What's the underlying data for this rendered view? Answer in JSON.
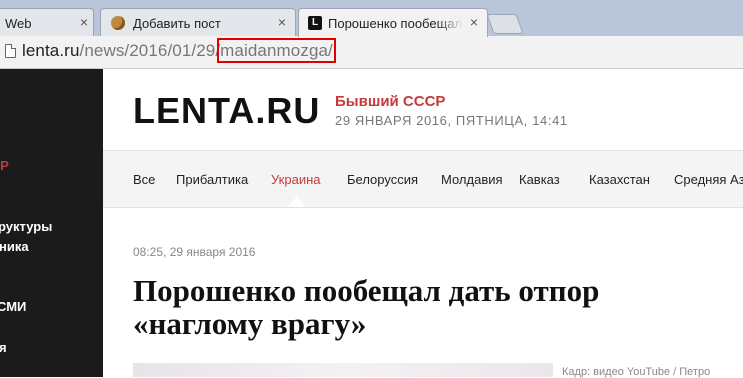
{
  "browser": {
    "tabs": [
      {
        "title": "Web"
      },
      {
        "title": "Добавить пост"
      },
      {
        "title": "Порошенко пообещал д",
        "favicon": "L"
      }
    ],
    "address": {
      "host": "lenta.ru",
      "path": "/news/2016/01/29",
      "sep": "/",
      "highlight": "maidanmozga/"
    }
  },
  "sidebar": {
    "items": [
      {
        "label": "ЗР"
      },
      {
        "label": "руктуры"
      },
      {
        "label": "ника"
      },
      {
        "label": "СМИ"
      },
      {
        "label": "я"
      }
    ]
  },
  "header": {
    "logo": "LENTA.RU",
    "section": "Бывший СССР",
    "date": "29 ЯНВАРЯ 2016, ПЯТНИЦА, 14:41"
  },
  "nav": {
    "items": [
      "Все",
      "Прибалтика",
      "Украина",
      "Белоруссия",
      "Молдавия",
      "Кавказ",
      "Казахстан",
      "Средняя Аз"
    ],
    "active_index": 2
  },
  "article": {
    "time": "08:25, 29 января 2016",
    "title": "Порошенко пообещал дать отпор «наглому врагу»",
    "credit": "Кадр: видео YouTube / Петро"
  },
  "colors": {
    "accent": "#c43a3a",
    "sidebar_bg": "#1b1b1b",
    "highlight_box": "#e00000"
  }
}
